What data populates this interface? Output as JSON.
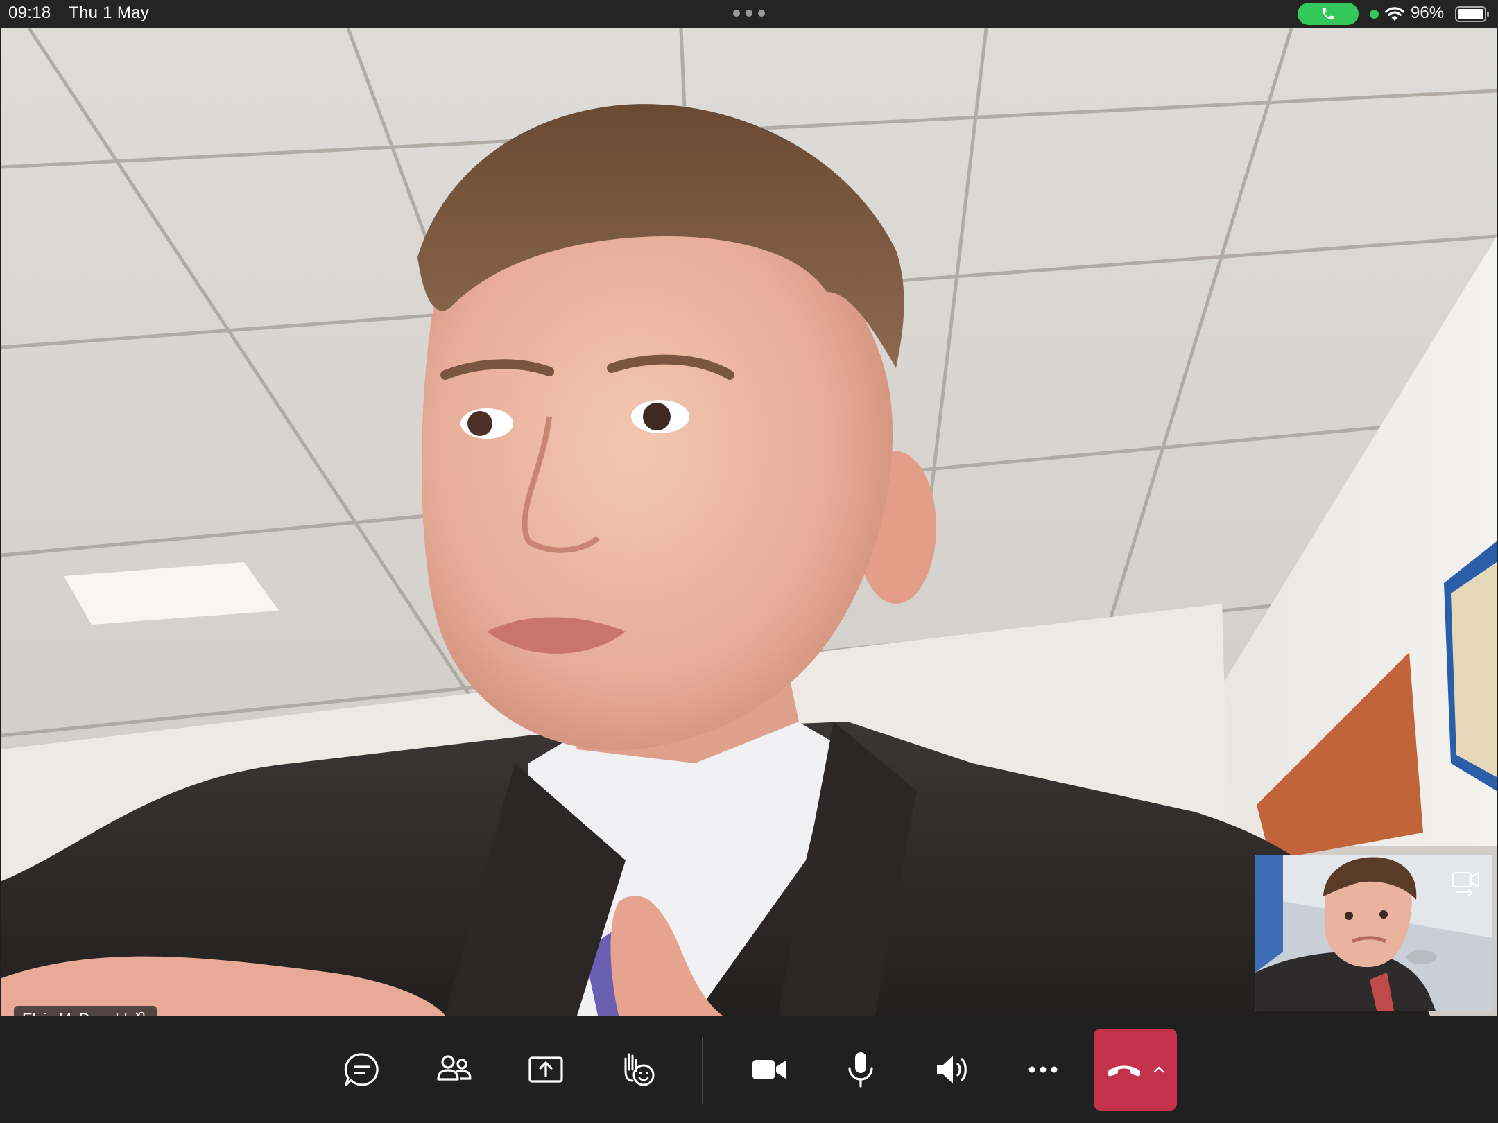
{
  "status_bar": {
    "time": "09:18",
    "date": "Thu 1 May",
    "battery_percent": "96%",
    "battery_level": 0.96,
    "call_active_color": "#34c759"
  },
  "main_video": {
    "participant_name": "Elvis McDonald",
    "participant_muted": true
  },
  "controls": {
    "items": [
      {
        "name": "chat",
        "icon": "chat-icon"
      },
      {
        "name": "people",
        "icon": "people-icon"
      },
      {
        "name": "share",
        "icon": "share-screen-icon"
      },
      {
        "name": "reactions",
        "icon": "raise-hand-react-icon"
      },
      {
        "name": "camera",
        "icon": "video-camera-icon"
      },
      {
        "name": "microphone",
        "icon": "microphone-icon"
      },
      {
        "name": "speaker",
        "icon": "speaker-icon"
      },
      {
        "name": "more",
        "icon": "more-dots-icon"
      },
      {
        "name": "leave",
        "icon": "hang-up-icon"
      }
    ],
    "leave_color": "#c4314b"
  }
}
